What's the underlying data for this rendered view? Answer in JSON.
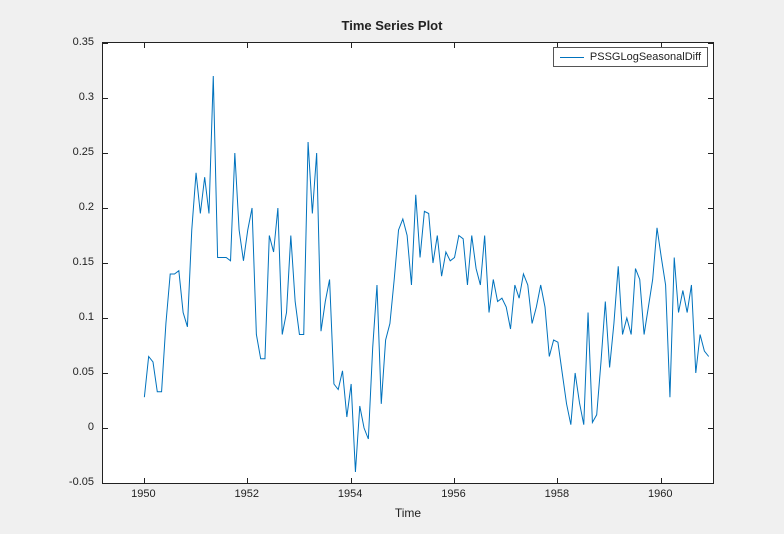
{
  "chart_data": {
    "type": "line",
    "title": "Time Series Plot",
    "xlabel": "Time",
    "ylabel": "",
    "xlim": [
      1949.2,
      1961.0
    ],
    "ylim": [
      -0.05,
      0.35
    ],
    "xticks": [
      1950,
      1952,
      1954,
      1956,
      1958,
      1960
    ],
    "yticks": [
      -0.05,
      0,
      0.05,
      0.1,
      0.15,
      0.2,
      0.25,
      0.3,
      0.35
    ],
    "series": [
      {
        "name": "PSSGLogSeasonalDiff",
        "color": "#0072bd",
        "x": [
          1950.0,
          1950.083,
          1950.167,
          1950.25,
          1950.333,
          1950.417,
          1950.5,
          1950.583,
          1950.667,
          1950.75,
          1950.833,
          1950.917,
          1951.0,
          1951.083,
          1951.167,
          1951.25,
          1951.333,
          1951.417,
          1951.5,
          1951.583,
          1951.667,
          1951.75,
          1951.833,
          1951.917,
          1952.0,
          1952.083,
          1952.167,
          1952.25,
          1952.333,
          1952.417,
          1952.5,
          1952.583,
          1952.667,
          1952.75,
          1952.833,
          1952.917,
          1953.0,
          1953.083,
          1953.167,
          1953.25,
          1953.333,
          1953.417,
          1953.5,
          1953.583,
          1953.667,
          1953.75,
          1953.833,
          1953.917,
          1954.0,
          1954.083,
          1954.167,
          1954.25,
          1954.333,
          1954.417,
          1954.5,
          1954.583,
          1954.667,
          1954.75,
          1954.833,
          1954.917,
          1955.0,
          1955.083,
          1955.167,
          1955.25,
          1955.333,
          1955.417,
          1955.5,
          1955.583,
          1955.667,
          1955.75,
          1955.833,
          1955.917,
          1956.0,
          1956.083,
          1956.167,
          1956.25,
          1956.333,
          1956.417,
          1956.5,
          1956.583,
          1956.667,
          1956.75,
          1956.833,
          1956.917,
          1957.0,
          1957.083,
          1957.167,
          1957.25,
          1957.333,
          1957.417,
          1957.5,
          1957.583,
          1957.667,
          1957.75,
          1957.833,
          1957.917,
          1958.0,
          1958.083,
          1958.167,
          1958.25,
          1958.333,
          1958.417,
          1958.5,
          1958.583,
          1958.667,
          1958.75,
          1958.833,
          1958.917,
          1959.0,
          1959.083,
          1959.167,
          1959.25,
          1959.333,
          1959.417,
          1959.5,
          1959.583,
          1959.667,
          1959.75,
          1959.833,
          1959.917,
          1960.0,
          1960.083,
          1960.167,
          1960.25,
          1960.333,
          1960.417,
          1960.5,
          1960.583,
          1960.667,
          1960.75,
          1960.833,
          1960.917
        ],
        "values": [
          0.028,
          0.065,
          0.06,
          0.033,
          0.033,
          0.095,
          0.14,
          0.14,
          0.143,
          0.105,
          0.092,
          0.18,
          0.232,
          0.195,
          0.228,
          0.195,
          0.32,
          0.155,
          0.155,
          0.155,
          0.152,
          0.25,
          0.18,
          0.152,
          0.18,
          0.2,
          0.085,
          0.063,
          0.063,
          0.175,
          0.16,
          0.2,
          0.085,
          0.105,
          0.175,
          0.115,
          0.085,
          0.085,
          0.26,
          0.195,
          0.25,
          0.088,
          0.115,
          0.135,
          0.04,
          0.035,
          0.052,
          0.01,
          0.04,
          -0.04,
          0.02,
          0.0,
          -0.01,
          0.073,
          0.13,
          0.022,
          0.08,
          0.095,
          0.135,
          0.18,
          0.19,
          0.175,
          0.13,
          0.212,
          0.155,
          0.197,
          0.195,
          0.15,
          0.175,
          0.138,
          0.16,
          0.152,
          0.155,
          0.175,
          0.172,
          0.13,
          0.175,
          0.145,
          0.13,
          0.175,
          0.105,
          0.135,
          0.115,
          0.118,
          0.11,
          0.09,
          0.13,
          0.118,
          0.14,
          0.13,
          0.095,
          0.11,
          0.13,
          0.11,
          0.065,
          0.08,
          0.078,
          0.05,
          0.022,
          0.003,
          0.05,
          0.023,
          0.003,
          0.105,
          0.005,
          0.012,
          0.06,
          0.115,
          0.055,
          0.095,
          0.147,
          0.085,
          0.1,
          0.085,
          0.145,
          0.135,
          0.085,
          0.11,
          0.135,
          0.182,
          0.155,
          0.13,
          0.028,
          0.155,
          0.105,
          0.125,
          0.105,
          0.13,
          0.05,
          0.085,
          0.07,
          0.065
        ]
      }
    ],
    "legend": {
      "entries": [
        "PSSGLogSeasonalDiff"
      ],
      "position": "northeast"
    }
  }
}
